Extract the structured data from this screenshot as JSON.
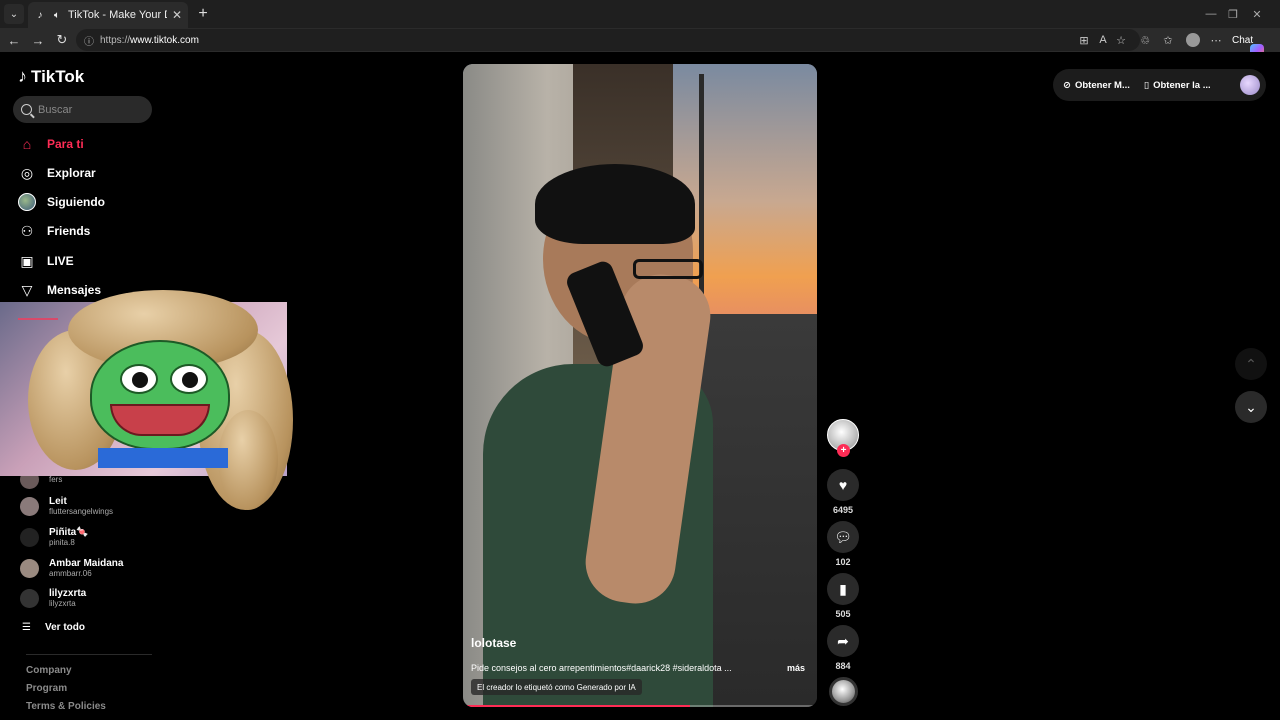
{
  "browser": {
    "tab_title": "TikTok - Make Your Day",
    "url_prefix": "https://",
    "url_host": "www.tiktok.com",
    "chat_label": "Chat"
  },
  "sidebar": {
    "logo_text": "TikTok",
    "search_placeholder": "Buscar",
    "nav": [
      {
        "label": "Para ti",
        "icon": "home-icon"
      },
      {
        "label": "Explorar",
        "icon": "compass-icon"
      },
      {
        "label": "Siguiendo",
        "icon": "following-avatar"
      },
      {
        "label": "Friends",
        "icon": "friends-icon"
      },
      {
        "label": "LIVE",
        "icon": "live-icon"
      },
      {
        "label": "Mensajes",
        "icon": "send-icon"
      }
    ],
    "accounts": [
      {
        "name": "",
        "handle": "fers"
      },
      {
        "name": "Leit",
        "handle": "fluttersangelwings"
      },
      {
        "name": "Piñita🍬",
        "handle": "pinita.8"
      },
      {
        "name": "Ambar Maidana",
        "handle": "ammbarr.06"
      },
      {
        "name": "lilyzxrta",
        "handle": "lilyzxrta"
      }
    ],
    "see_all": "Ver todo",
    "footer": [
      "Company",
      "Program",
      "Terms & Policies"
    ]
  },
  "video": {
    "username": "lolotase",
    "description": "Pide consejos al cero arrepentimientos#daarick28 #sideraldota ...",
    "more_label": "más",
    "ai_label": "El creador lo etiquetó como Generado por IA",
    "progress": 0.64
  },
  "actions": {
    "likes": "6495",
    "comments": "102",
    "saves": "505",
    "shares": "884"
  },
  "topbar": {
    "coins_label": "Obtener M...",
    "app_label": "Obtener la ..."
  },
  "colors": {
    "accent": "#fe2c55",
    "background": "#000000"
  }
}
